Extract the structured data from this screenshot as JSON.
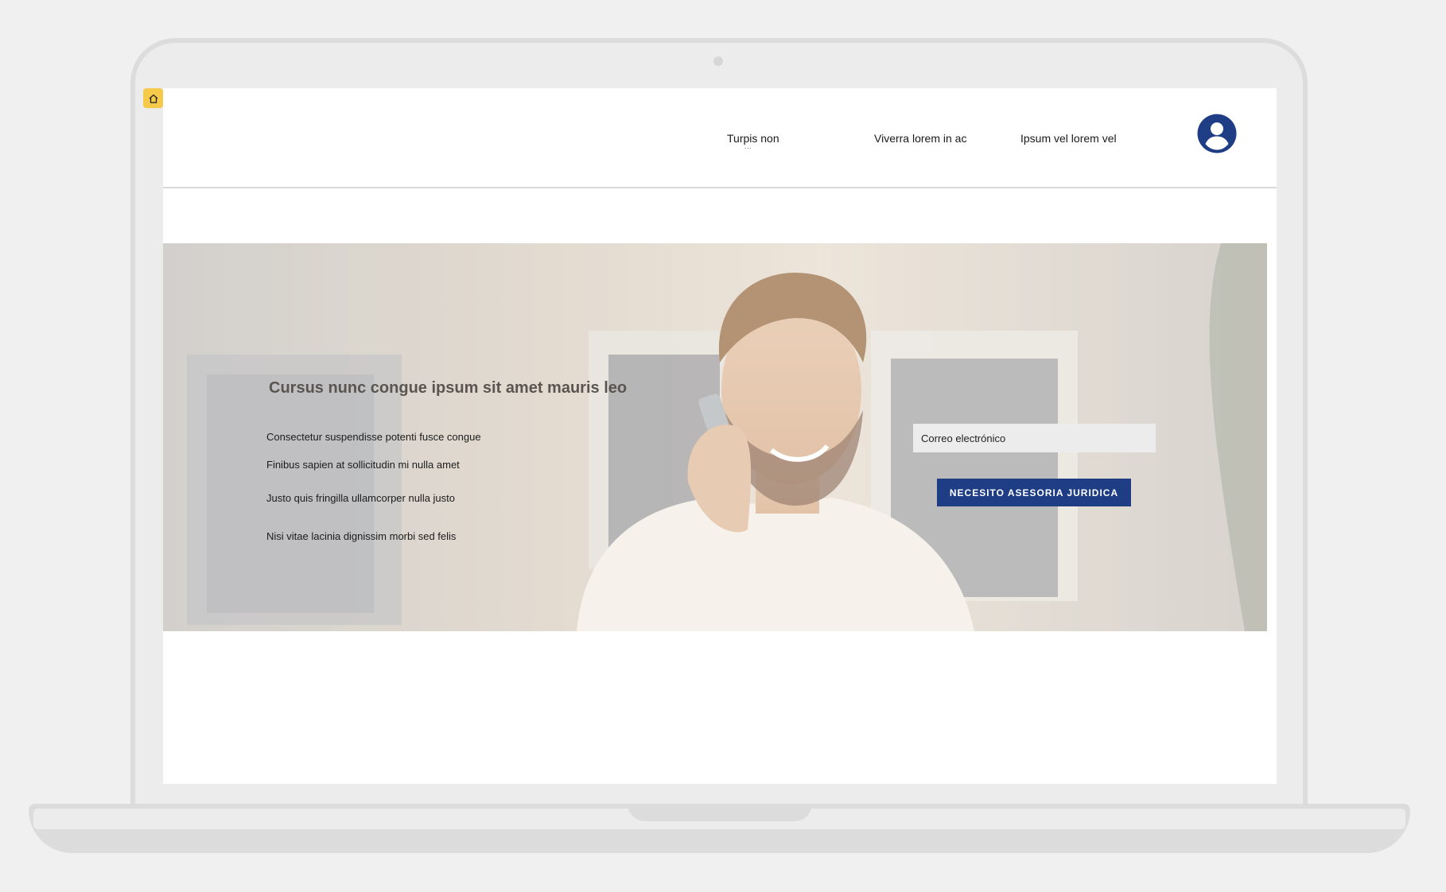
{
  "nav": {
    "items": [
      {
        "label": "Turpis non",
        "sub": "..."
      },
      {
        "label": "Viverra lorem in ac"
      },
      {
        "label": "Ipsum vel lorem vel"
      }
    ]
  },
  "hero": {
    "title": "Cursus nunc congue ipsum sit amet mauris leo",
    "lines": [
      "Consectetur suspendisse potenti fusce congue",
      "Finibus sapien at sollicitudin mi nulla amet",
      "Justo quis fringilla ullamcorper nulla justo",
      "Nisi vitae lacinia dignissim morbi sed felis"
    ],
    "email_placeholder": "Correo electrónico",
    "cta_label": "NECESITO ASESORIA JURIDICA"
  },
  "colors": {
    "accent": "#1e3d85",
    "badge": "#f5c94a"
  },
  "icons": {
    "badge": "home-icon",
    "profile": "user-avatar-icon"
  }
}
